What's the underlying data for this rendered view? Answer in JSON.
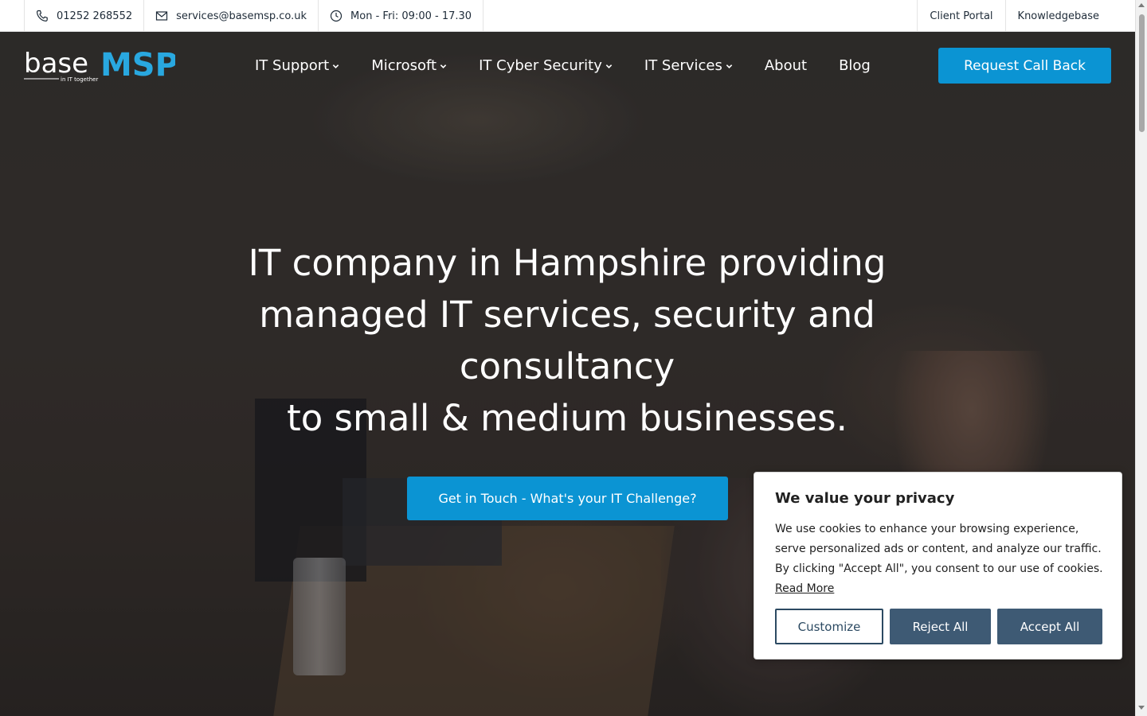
{
  "topbar": {
    "phone": "01252 268552",
    "email": "services@basemsp.co.uk",
    "hours": "Mon - Fri: 09:00 - 17.30",
    "client_portal": "Client Portal",
    "knowledgebase": "Knowledgebase"
  },
  "logo": {
    "text_base": "base",
    "text_msp": "MSP",
    "tagline": "in IT together"
  },
  "nav": {
    "items": [
      {
        "label": "IT Support",
        "dropdown": true
      },
      {
        "label": "Microsoft",
        "dropdown": true
      },
      {
        "label": "IT Cyber Security",
        "dropdown": true
      },
      {
        "label": "IT Services",
        "dropdown": true
      },
      {
        "label": "About",
        "dropdown": false
      },
      {
        "label": "Blog",
        "dropdown": false
      }
    ],
    "cta": "Request Call Back"
  },
  "hero": {
    "headline_1": "IT company in Hampshire providing",
    "headline_2": "managed IT services, security and",
    "headline_3": "consultancy",
    "headline_4": "to small & medium businesses.",
    "button": "Get in Touch - What's your IT Challenge?"
  },
  "cookie": {
    "title": "We value your privacy",
    "body": "We use cookies to enhance your browsing experience, serve personalized ads or content, and analyze our traffic. By clicking \"Accept All\", you consent to our use of cookies.",
    "read_more": "Read More",
    "customize": "Customize",
    "reject": "Reject All",
    "accept": "Accept All"
  },
  "colors": {
    "accent": "#0b94d3",
    "cookie_button": "#3e5a74",
    "logo_msp": "#29a8e0"
  }
}
